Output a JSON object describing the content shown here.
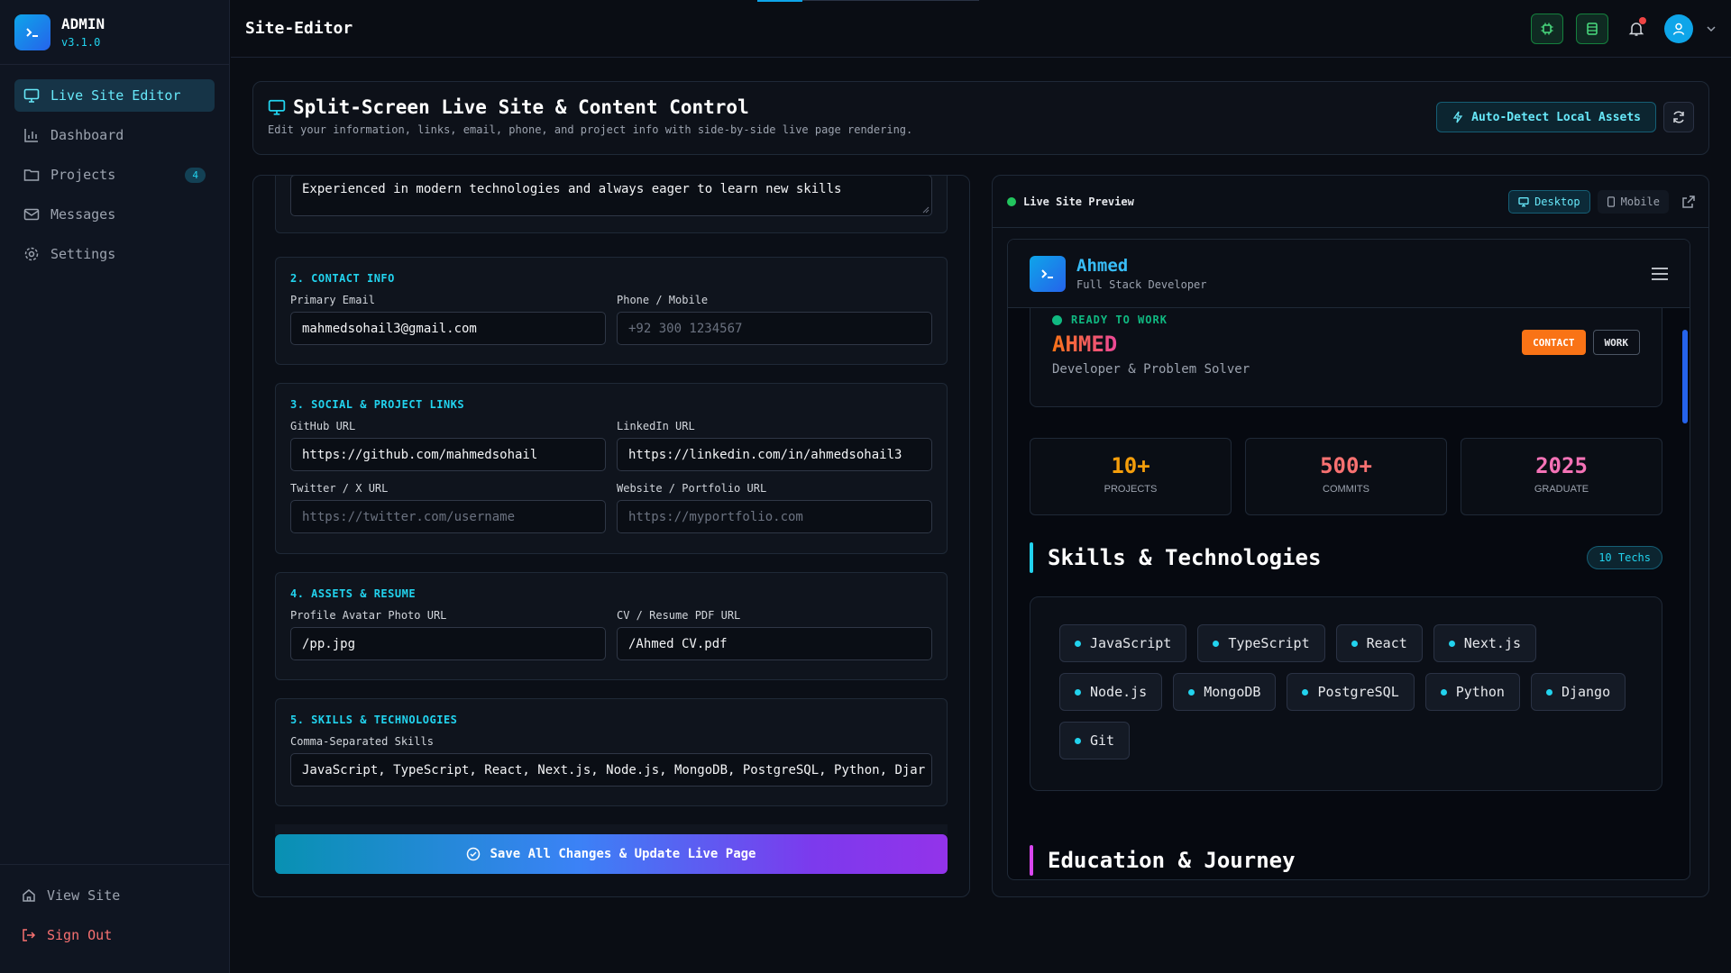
{
  "sidebar": {
    "brand_title": "ADMIN",
    "brand_version": "v3.1.0",
    "items": [
      {
        "label": "Live Site Editor",
        "icon": "monitor-icon"
      },
      {
        "label": "Dashboard",
        "icon": "bar-chart-icon"
      },
      {
        "label": "Projects",
        "icon": "folder-icon",
        "badge": "4"
      },
      {
        "label": "Messages",
        "icon": "mail-icon"
      },
      {
        "label": "Settings",
        "icon": "gear-icon"
      }
    ],
    "footer": [
      {
        "label": "View Site",
        "icon": "home-icon"
      },
      {
        "label": "Sign Out",
        "icon": "sign-out-icon"
      }
    ]
  },
  "topbar": {
    "title": "Site-Editor"
  },
  "header": {
    "title": "Split-Screen Live Site & Content Control",
    "subtitle": "Edit your information, links, email, phone, and project info with side-by-side live page rendering.",
    "auto_detect_label": "Auto-Detect Local Assets"
  },
  "editor": {
    "bio_value": "Experienced in modern technologies and always eager to learn new skills",
    "contact": {
      "title": "2. CONTACT INFO",
      "email_label": "Primary Email",
      "email_value": "mahmedsohail3@gmail.com",
      "phone_label": "Phone / Mobile",
      "phone_placeholder": "+92 300 1234567"
    },
    "links": {
      "title": "3. SOCIAL & PROJECT LINKS",
      "github_label": "GitHub URL",
      "github_value": "https://github.com/mahmedsohail",
      "linkedin_label": "LinkedIn URL",
      "linkedin_value": "https://linkedin.com/in/ahmedsohail3",
      "twitter_label": "Twitter / X URL",
      "twitter_placeholder": "https://twitter.com/username",
      "website_label": "Website / Portfolio URL",
      "website_placeholder": "https://myportfolio.com"
    },
    "assets": {
      "title": "4. ASSETS & RESUME",
      "avatar_label": "Profile Avatar Photo URL",
      "avatar_value": "/pp.jpg",
      "cv_label": "CV / Resume PDF URL",
      "cv_value": "/Ahmed CV.pdf"
    },
    "skills": {
      "title": "5. SKILLS & TECHNOLOGIES",
      "label": "Comma-Separated Skills",
      "value": "JavaScript, TypeScript, React, Next.js, Node.js, MongoDB, PostgreSQL, Python, Djar"
    },
    "save_label": "Save All Changes & Update Live Page"
  },
  "preview": {
    "label": "Live Site Preview",
    "desktop_label": "Desktop",
    "mobile_label": "Mobile",
    "site": {
      "name": "Ahmed",
      "role": "Full Stack Developer",
      "status": "READY TO WORK",
      "hero_name": "AHMED",
      "hero_sub": "Developer & Problem Solver",
      "contact_btn": "CONTACT",
      "work_btn": "WORK",
      "stats": [
        {
          "value": "10+",
          "label": "PROJECTS",
          "color": "#f59e0b"
        },
        {
          "value": "500+",
          "label": "COMMITS",
          "color": "#f87171"
        },
        {
          "value": "2025",
          "label": "GRADUATE",
          "color": "#f472b6"
        }
      ],
      "skills_title": "Skills & Technologies",
      "skills_badge": "10 Techs",
      "skills": [
        "JavaScript",
        "TypeScript",
        "React",
        "Next.js",
        "Node.js",
        "MongoDB",
        "PostgreSQL",
        "Python",
        "Django",
        "Git"
      ],
      "education_title": "Education & Journey"
    }
  },
  "colors": {
    "accent": "#22d3ee",
    "background": "#0a0d14",
    "save_gradient_start": "#0891b2",
    "save_gradient_end": "#9333ea"
  }
}
